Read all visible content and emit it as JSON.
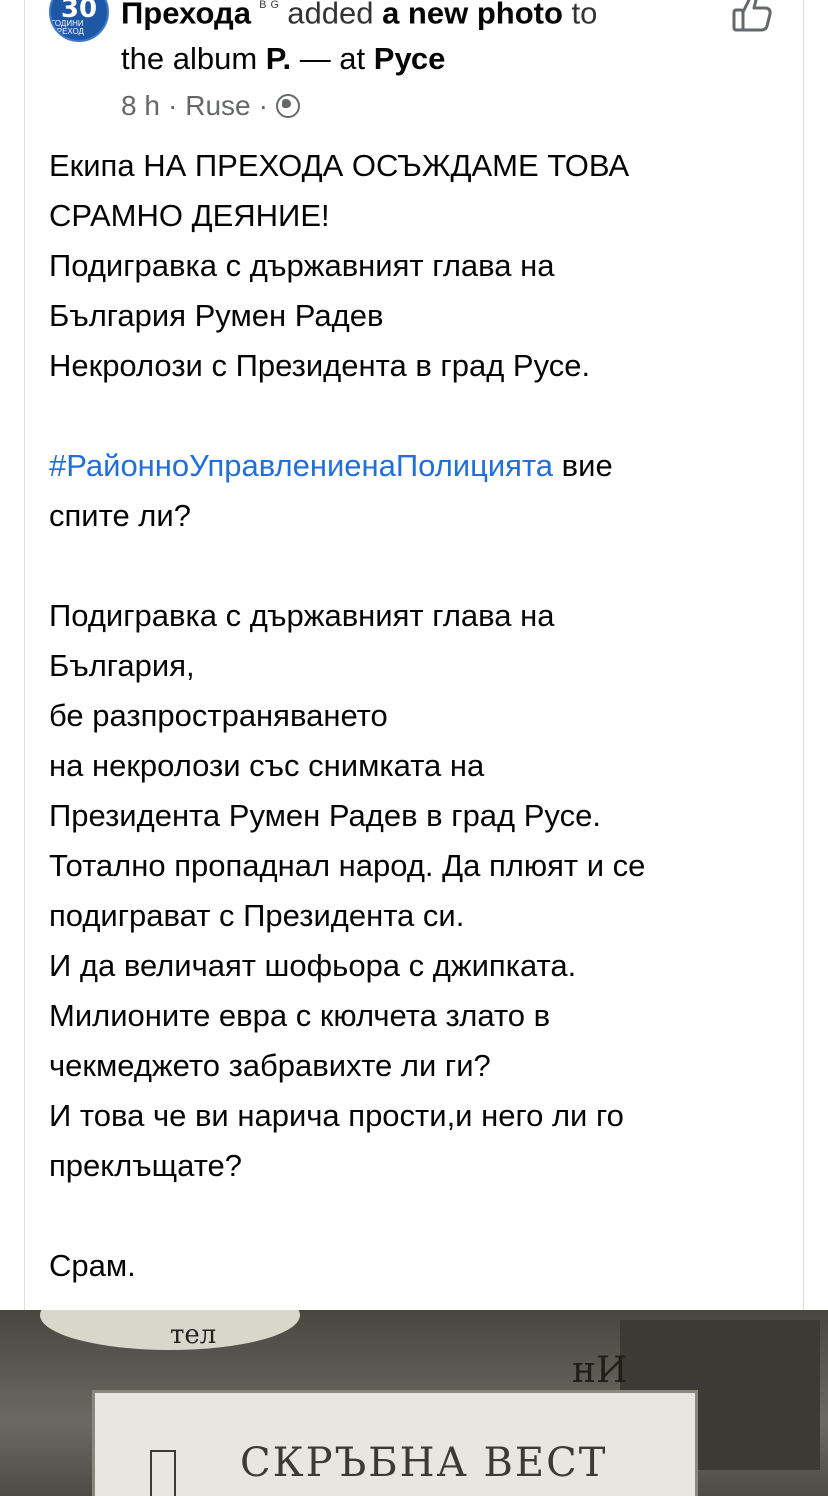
{
  "post": {
    "author": "Прехода",
    "author_badge": "ᴮ ᴳ",
    "action_text": "added",
    "action_bold": "a new photo",
    "to_text": "to",
    "album_prefix": "the album",
    "album_name": "P.",
    "location_sep": "— at",
    "location": "Русе",
    "time": "8 h",
    "place": "Ruse",
    "dot": "·",
    "avatar_text": "30",
    "avatar_sub": "ГОДИНИ ПРЕХОД"
  },
  "body": {
    "lines": [
      "Екипа НА ПРЕХОДА ОСЪЖДАМЕ ТОВА",
      "СРАМНО ДЕЯНИЕ!",
      "Подигравка с държавният глава на",
      "България Румен Радев",
      "Некролози с Президента в град Русе."
    ],
    "hashtag": "#РайонноУправлениенаПолицията",
    "hashtag_after": " вие",
    "hashtag_line2": "спите ли?",
    "lines2": [
      "Подигравка с държавният глава на",
      "България,",
      "бе разпространяването",
      "на некролози със снимката на",
      "Президента Румен Радев в град Русе.",
      "Тотално пропаднал народ. Да плюят и се",
      "подиграват с Президента си.",
      "И да величаят шофьора с джипката.",
      "Милионите евра с кюлчета злато в",
      "чекмеджето забравихте ли ги?",
      "И това че ви нарича прости,и него ли го",
      "преклъщате?"
    ],
    "closing": "Срам."
  },
  "photo": {
    "sign_text": "СКРЪБНА ВЕСТ",
    "fragment1": "тел",
    "fragment2": "нИ"
  },
  "icons": {
    "like": "thumbs-up-icon",
    "privacy": "globe-icon"
  },
  "colors": {
    "hashtag": "#216fdb",
    "muted": "#65676b"
  }
}
